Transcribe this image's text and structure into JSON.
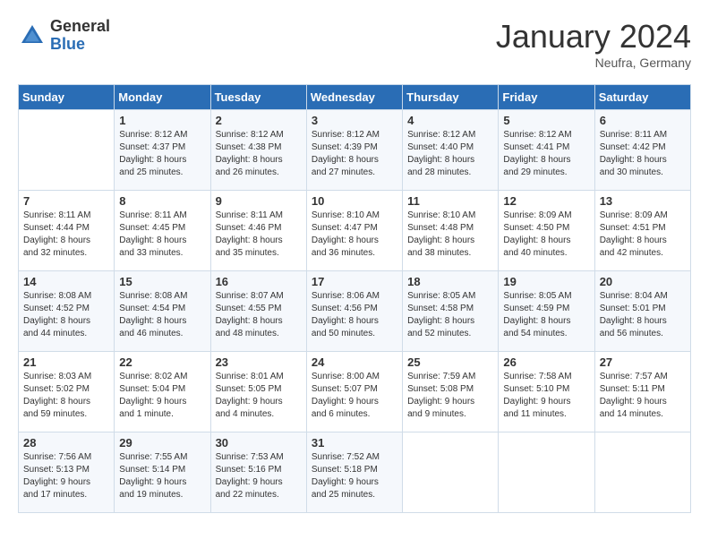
{
  "header": {
    "logo_general": "General",
    "logo_blue": "Blue",
    "month_title": "January 2024",
    "location": "Neufra, Germany"
  },
  "weekdays": [
    "Sunday",
    "Monday",
    "Tuesday",
    "Wednesday",
    "Thursday",
    "Friday",
    "Saturday"
  ],
  "weeks": [
    [
      {
        "day": "",
        "info": ""
      },
      {
        "day": "1",
        "info": "Sunrise: 8:12 AM\nSunset: 4:37 PM\nDaylight: 8 hours\nand 25 minutes."
      },
      {
        "day": "2",
        "info": "Sunrise: 8:12 AM\nSunset: 4:38 PM\nDaylight: 8 hours\nand 26 minutes."
      },
      {
        "day": "3",
        "info": "Sunrise: 8:12 AM\nSunset: 4:39 PM\nDaylight: 8 hours\nand 27 minutes."
      },
      {
        "day": "4",
        "info": "Sunrise: 8:12 AM\nSunset: 4:40 PM\nDaylight: 8 hours\nand 28 minutes."
      },
      {
        "day": "5",
        "info": "Sunrise: 8:12 AM\nSunset: 4:41 PM\nDaylight: 8 hours\nand 29 minutes."
      },
      {
        "day": "6",
        "info": "Sunrise: 8:11 AM\nSunset: 4:42 PM\nDaylight: 8 hours\nand 30 minutes."
      }
    ],
    [
      {
        "day": "7",
        "info": "Sunrise: 8:11 AM\nSunset: 4:44 PM\nDaylight: 8 hours\nand 32 minutes."
      },
      {
        "day": "8",
        "info": "Sunrise: 8:11 AM\nSunset: 4:45 PM\nDaylight: 8 hours\nand 33 minutes."
      },
      {
        "day": "9",
        "info": "Sunrise: 8:11 AM\nSunset: 4:46 PM\nDaylight: 8 hours\nand 35 minutes."
      },
      {
        "day": "10",
        "info": "Sunrise: 8:10 AM\nSunset: 4:47 PM\nDaylight: 8 hours\nand 36 minutes."
      },
      {
        "day": "11",
        "info": "Sunrise: 8:10 AM\nSunset: 4:48 PM\nDaylight: 8 hours\nand 38 minutes."
      },
      {
        "day": "12",
        "info": "Sunrise: 8:09 AM\nSunset: 4:50 PM\nDaylight: 8 hours\nand 40 minutes."
      },
      {
        "day": "13",
        "info": "Sunrise: 8:09 AM\nSunset: 4:51 PM\nDaylight: 8 hours\nand 42 minutes."
      }
    ],
    [
      {
        "day": "14",
        "info": "Sunrise: 8:08 AM\nSunset: 4:52 PM\nDaylight: 8 hours\nand 44 minutes."
      },
      {
        "day": "15",
        "info": "Sunrise: 8:08 AM\nSunset: 4:54 PM\nDaylight: 8 hours\nand 46 minutes."
      },
      {
        "day": "16",
        "info": "Sunrise: 8:07 AM\nSunset: 4:55 PM\nDaylight: 8 hours\nand 48 minutes."
      },
      {
        "day": "17",
        "info": "Sunrise: 8:06 AM\nSunset: 4:56 PM\nDaylight: 8 hours\nand 50 minutes."
      },
      {
        "day": "18",
        "info": "Sunrise: 8:05 AM\nSunset: 4:58 PM\nDaylight: 8 hours\nand 52 minutes."
      },
      {
        "day": "19",
        "info": "Sunrise: 8:05 AM\nSunset: 4:59 PM\nDaylight: 8 hours\nand 54 minutes."
      },
      {
        "day": "20",
        "info": "Sunrise: 8:04 AM\nSunset: 5:01 PM\nDaylight: 8 hours\nand 56 minutes."
      }
    ],
    [
      {
        "day": "21",
        "info": "Sunrise: 8:03 AM\nSunset: 5:02 PM\nDaylight: 8 hours\nand 59 minutes."
      },
      {
        "day": "22",
        "info": "Sunrise: 8:02 AM\nSunset: 5:04 PM\nDaylight: 9 hours\nand 1 minute."
      },
      {
        "day": "23",
        "info": "Sunrise: 8:01 AM\nSunset: 5:05 PM\nDaylight: 9 hours\nand 4 minutes."
      },
      {
        "day": "24",
        "info": "Sunrise: 8:00 AM\nSunset: 5:07 PM\nDaylight: 9 hours\nand 6 minutes."
      },
      {
        "day": "25",
        "info": "Sunrise: 7:59 AM\nSunset: 5:08 PM\nDaylight: 9 hours\nand 9 minutes."
      },
      {
        "day": "26",
        "info": "Sunrise: 7:58 AM\nSunset: 5:10 PM\nDaylight: 9 hours\nand 11 minutes."
      },
      {
        "day": "27",
        "info": "Sunrise: 7:57 AM\nSunset: 5:11 PM\nDaylight: 9 hours\nand 14 minutes."
      }
    ],
    [
      {
        "day": "28",
        "info": "Sunrise: 7:56 AM\nSunset: 5:13 PM\nDaylight: 9 hours\nand 17 minutes."
      },
      {
        "day": "29",
        "info": "Sunrise: 7:55 AM\nSunset: 5:14 PM\nDaylight: 9 hours\nand 19 minutes."
      },
      {
        "day": "30",
        "info": "Sunrise: 7:53 AM\nSunset: 5:16 PM\nDaylight: 9 hours\nand 22 minutes."
      },
      {
        "day": "31",
        "info": "Sunrise: 7:52 AM\nSunset: 5:18 PM\nDaylight: 9 hours\nand 25 minutes."
      },
      {
        "day": "",
        "info": ""
      },
      {
        "day": "",
        "info": ""
      },
      {
        "day": "",
        "info": ""
      }
    ]
  ]
}
